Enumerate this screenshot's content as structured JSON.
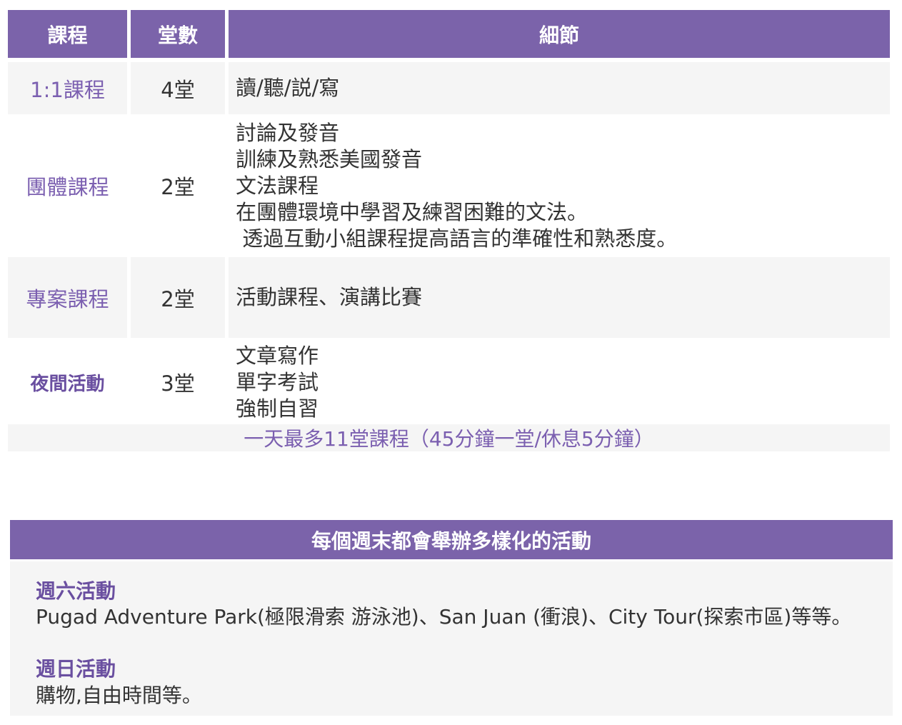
{
  "schedule_table": {
    "headers": {
      "course": "課程",
      "count": "堂數",
      "detail": "細節"
    },
    "rows": [
      {
        "course": "1:1課程",
        "count": "4堂",
        "details": [
          "讀/聽/説/寫"
        ]
      },
      {
        "course": "團體課程",
        "count": "2堂",
        "details": [
          "討論及發音",
          "訓練及熟悉美國發音",
          "文法課程",
          "在團體環境中學習及練習困難的文法。",
          " 透過互動小組課程提高語言的準確性和熟悉度。"
        ]
      },
      {
        "course": "專案課程",
        "count": "2堂",
        "details": [
          "活動課程、演講比賽"
        ]
      },
      {
        "course": "夜間活動",
        "count": "3堂",
        "details": [
          "文章寫作",
          "單字考試",
          "強制自習"
        ]
      }
    ],
    "note": "一天最多11堂課程（45分鐘一堂/休息5分鐘）"
  },
  "weekend": {
    "header": "每個週末都會舉辦多樣化的活動",
    "saturday_title": "週六活動",
    "saturday_text": "Pugad Adventure Park(極限滑索 游泳池)、San Juan (衝浪)、City Tour(探索市區)等等。",
    "sunday_title": "週日活動",
    "sunday_text": "購物,自由時間等。"
  },
  "colors": {
    "header_purple": "#7b63aa",
    "accent_purple": "#7b5fb0",
    "row_gray": "#f5f5f5"
  }
}
